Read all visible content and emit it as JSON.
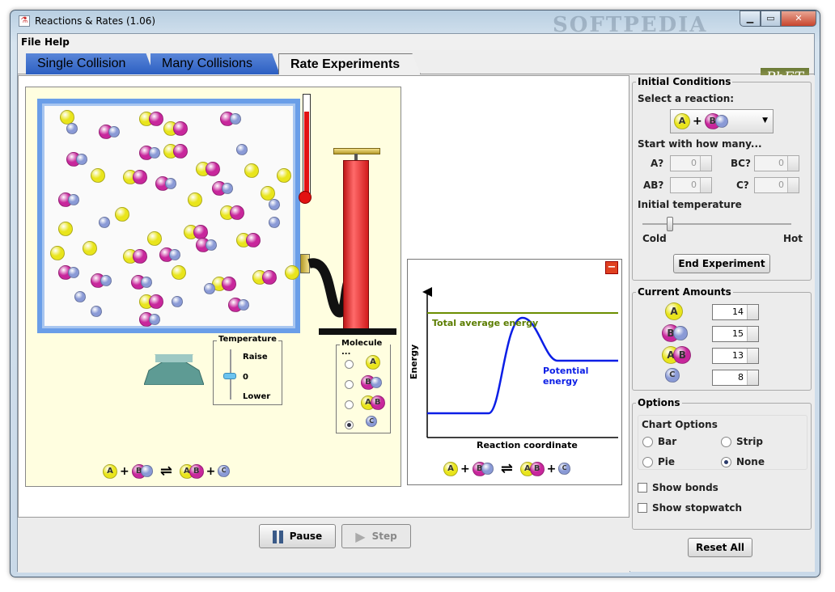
{
  "window": {
    "title": "Reactions & Rates (1.06)",
    "watermark": "SOFTPEDIA"
  },
  "menu": {
    "file": "File",
    "help": "Help"
  },
  "tabs": [
    {
      "label": "Single Collision",
      "active": false
    },
    {
      "label": "Many Collisions",
      "active": false
    },
    {
      "label": "Rate Experiments",
      "active": true
    }
  ],
  "logo": "PhET",
  "simulation": {
    "temperature_box": {
      "title": "Temperature",
      "raise": "Raise",
      "zero": "0",
      "lower": "Lower"
    },
    "molecule_box": {
      "title": "Molecule ...",
      "options": [
        "A",
        "BC",
        "AB",
        "C"
      ],
      "selected": 3
    },
    "equation": {
      "a": "A",
      "bc": "BC",
      "ab": "AB",
      "c": "C",
      "plus": "+"
    }
  },
  "energy_chart": {
    "ylabel": "Energy",
    "xlabel": "Reaction coordinate",
    "total_label": "Total average energy",
    "potential_label": "Potential energy",
    "colors": {
      "total": "#6b8e00",
      "potential": "#0b1ee6"
    },
    "close_button": "−"
  },
  "controls": {
    "pause": "Pause",
    "step": "Step",
    "reset_all": "Reset All"
  },
  "initial_conditions": {
    "title": "Initial Conditions",
    "select_reaction": "Select a reaction:",
    "start_with": "Start with how many...",
    "counts": [
      {
        "label": "A?",
        "value": "0"
      },
      {
        "label": "BC?",
        "value": "0"
      },
      {
        "label": "AB?",
        "value": "0"
      },
      {
        "label": "C?",
        "value": "0"
      }
    ],
    "initial_temperature": "Initial temperature",
    "cold": "Cold",
    "hot": "Hot",
    "end_experiment": "End Experiment"
  },
  "current_amounts": {
    "title": "Current Amounts",
    "rows": [
      {
        "species": "A",
        "value": "14"
      },
      {
        "species": "BC",
        "value": "15"
      },
      {
        "species": "AB",
        "value": "13"
      },
      {
        "species": "C",
        "value": "8"
      }
    ]
  },
  "options": {
    "title": "Options",
    "chart_options": "Chart Options",
    "bar": "Bar",
    "strip": "Strip",
    "pie": "Pie",
    "none": "None",
    "show_bonds": "Show bonds",
    "show_stopwatch": "Show stopwatch"
  },
  "colors": {
    "a_yellow": "#e9e51c",
    "b_magenta": "#c8279c",
    "c_blue": "#8a9ad6",
    "tab_blue": "#2c5fc2"
  }
}
